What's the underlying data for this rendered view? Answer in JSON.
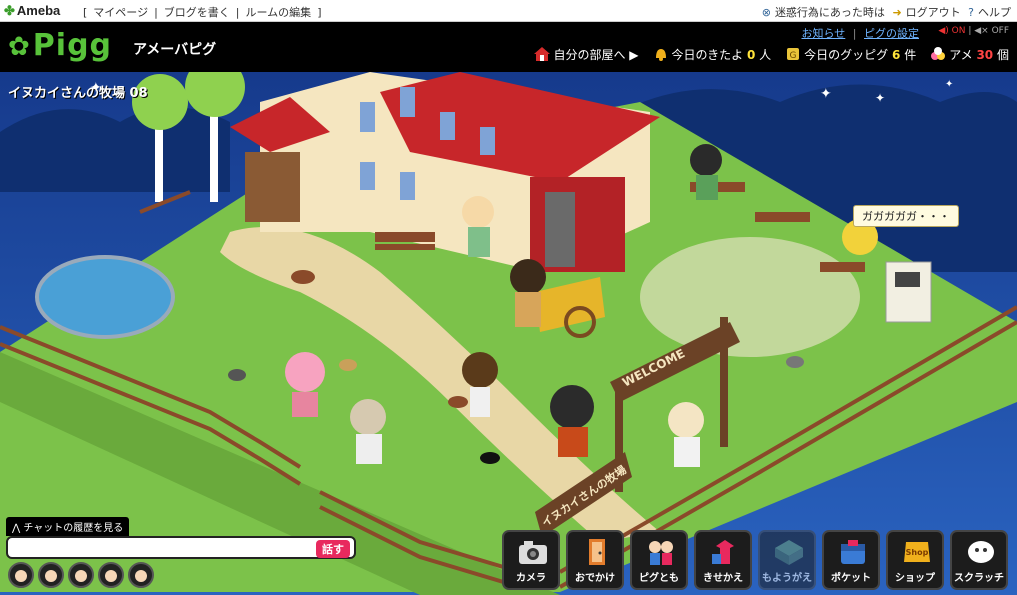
{
  "topbar": {
    "logo": "Ameba",
    "links": [
      "[",
      "マイページ",
      "|",
      "ブログを書く",
      "|",
      "ルームの編集",
      "]"
    ],
    "report": "迷惑行為にあった時は",
    "logout": "ログアウト",
    "help": "ヘルプ"
  },
  "header": {
    "logo": "Pigg",
    "brand": "アメーバピグ",
    "notice": "お知らせ",
    "pigg_settings": "ピグの設定",
    "sound_on": "ON",
    "sound_off": "OFF",
    "my_room": "自分の部屋へ",
    "visitors_label": "今日のきたよ",
    "visitors_count": "0",
    "visitors_unit": "人",
    "goods_label": "今日のグッピグ",
    "goods_count": "6",
    "goods_unit": "件",
    "ame_label": "アメ",
    "ame_count": "30",
    "ame_unit": "個"
  },
  "game": {
    "room_name": "イヌカイさんの牧場 08",
    "speech": "ガガガガガ・・・",
    "welcome_sign": "WELCOME",
    "farm_sign": "イヌカイさんの牧場"
  },
  "chat": {
    "history": "チャットの履歴を見る",
    "talk": "話す"
  },
  "toolbar": [
    {
      "label": "カメラ",
      "icon": "camera-icon"
    },
    {
      "label": "おでかけ",
      "icon": "door-icon"
    },
    {
      "label": "ピグとも",
      "icon": "friends-icon"
    },
    {
      "label": "きせかえ",
      "icon": "clothes-icon"
    },
    {
      "label": "もようがえ",
      "icon": "room-icon",
      "disabled": true
    },
    {
      "label": "ポケット",
      "icon": "pocket-icon"
    },
    {
      "label": "ショップ",
      "icon": "shop-icon"
    },
    {
      "label": "スクラッチ",
      "icon": "scratch-icon"
    }
  ],
  "colors": {
    "accent_green": "#58c23a",
    "link_blue": "#6fb4ff",
    "count_yellow": "#ffe33a",
    "talk_pink": "#e8295e",
    "grass": "#7cc24a",
    "sky": "#1b3d8f"
  }
}
